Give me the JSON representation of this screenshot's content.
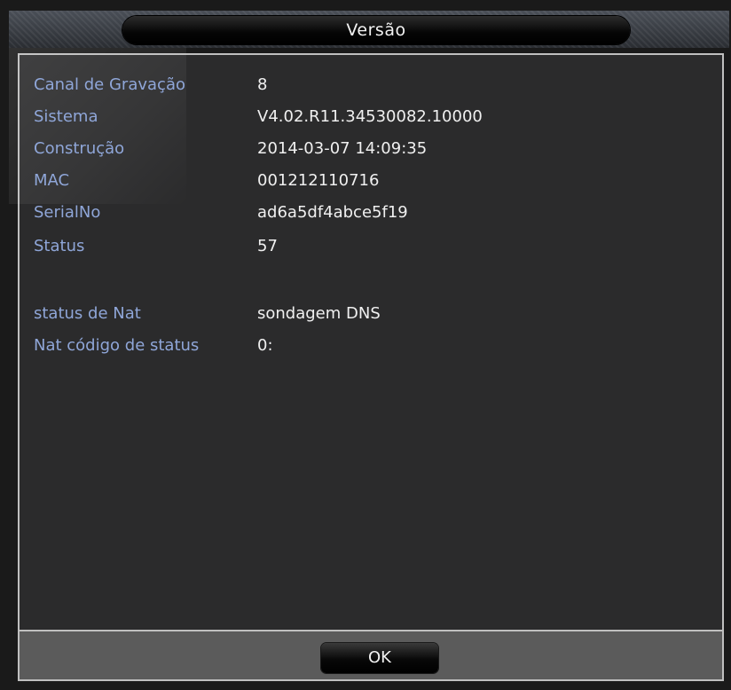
{
  "dialog": {
    "title": "Versão",
    "ok_label": "OK"
  },
  "info": [
    {
      "label": "Canal de Gravação",
      "value": "8"
    },
    {
      "label": "Sistema",
      "value": "V4.02.R11.34530082.10000"
    },
    {
      "label": "Construção",
      "value": "2014-03-07 14:09:35"
    },
    {
      "label": "MAC",
      "value": "001212110716"
    },
    {
      "label": "SerialNo",
      "value": "ad6a5df4abce5f19"
    },
    {
      "label": "Status",
      "value": "57"
    }
  ],
  "nat": [
    {
      "label": "status de Nat",
      "value": "sondagem DNS"
    },
    {
      "label": "Nat código de status",
      "value": "0:"
    }
  ],
  "colors": {
    "label": "#8fa6d8",
    "value": "#f0f0f0",
    "panel": "#2b2b2c"
  }
}
